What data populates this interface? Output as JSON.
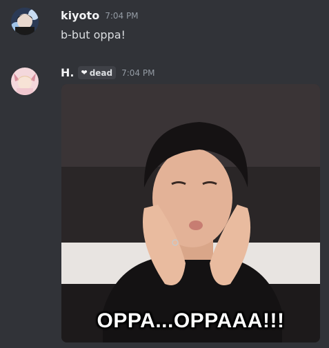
{
  "messages": [
    {
      "username": "kiyoto",
      "timestamp": "7:04 PM",
      "text": "b-but oppa!"
    },
    {
      "username": "H.",
      "tag_label": "dead",
      "tag_icon": "heart-icon",
      "timestamp": "7:04 PM",
      "gif_caption": "OPPA...OPPAAA!!!"
    }
  ],
  "colors": {
    "background": "#313338",
    "username": "#f2f3f5",
    "timestamp": "#949ba4",
    "text": "#dbdee1",
    "tag_bg": "#3f4147"
  }
}
